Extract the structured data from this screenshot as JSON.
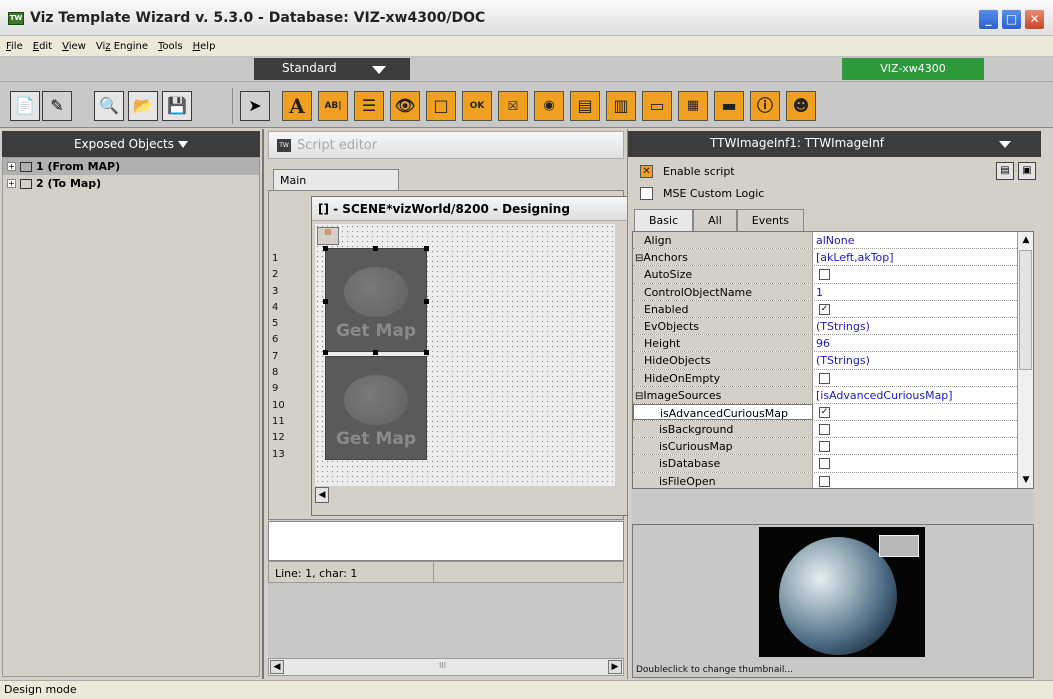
{
  "window": {
    "title": "Viz Template Wizard v. 5.3.0 - Database: VIZ-xw4300/DOC",
    "app_icon": "TW"
  },
  "menu": [
    {
      "label": "File",
      "u": "F"
    },
    {
      "label": "Edit",
      "u": "E"
    },
    {
      "label": "View",
      "u": "V"
    },
    {
      "label": "Viz Engine",
      "u": "z"
    },
    {
      "label": "Tools",
      "u": "T"
    },
    {
      "label": "Help",
      "u": "H"
    }
  ],
  "profile": {
    "selected": "Standard",
    "host": "VIZ-xw4300"
  },
  "colors": {
    "dark_header": "#3c3c3c",
    "host_green": "#2e9a3c",
    "accent_orange": "#f0a020",
    "value_blue": "#1a1ab8"
  },
  "left_panel": {
    "header": "Exposed Objects",
    "tree": [
      {
        "label": "1 (From MAP)"
      },
      {
        "label": "2 (To Map)"
      }
    ]
  },
  "script_editor": {
    "title": "Script editor",
    "tab": "Main",
    "design_title": "[] - SCENE*vizWorld/8200 - Designing",
    "line_numbers": [
      "1",
      "2",
      "3",
      "4",
      "5",
      "6",
      "7",
      "8",
      "9",
      "10",
      "11",
      "12",
      "13"
    ],
    "map_button_label": "Get Map",
    "status": "Line: 1, char: 1",
    "scroll_mark": "III"
  },
  "inspector": {
    "header": "TTWImageInf1: TTWImageInf",
    "enable_script": "Enable script",
    "mse_logic": "MSE Custom Logic",
    "tabs": [
      "Basic",
      "All",
      "Events"
    ],
    "properties": [
      {
        "name": "Align",
        "value": "alNone"
      },
      {
        "name": "Anchors",
        "value": "[akLeft,akTop]",
        "expandable": true
      },
      {
        "name": "AutoSize",
        "checkbox": false
      },
      {
        "name": "ControlObjectName",
        "value": "1"
      },
      {
        "name": "Enabled",
        "checkbox": true
      },
      {
        "name": "EvObjects",
        "value": "(TStrings)"
      },
      {
        "name": "Height",
        "value": "96"
      },
      {
        "name": "HideObjects",
        "value": "(TStrings)"
      },
      {
        "name": "HideOnEmpty",
        "checkbox": false
      },
      {
        "name": "ImageSources",
        "value": "[isAdvancedCuriousMap]",
        "expandable": true
      },
      {
        "name": "isAdvancedCuriousMap",
        "checkbox": true,
        "sub": true,
        "selected": true
      },
      {
        "name": "isBackground",
        "checkbox": false,
        "sub": true
      },
      {
        "name": "isCuriousMap",
        "checkbox": false,
        "sub": true
      },
      {
        "name": "isDatabase",
        "checkbox": false,
        "sub": true
      },
      {
        "name": "isFileOpen",
        "checkbox": false,
        "sub": true
      }
    ],
    "thumbnail_caption": "Doubleclick to change thumbnail..."
  },
  "statusbar": {
    "text": "Design mode"
  }
}
